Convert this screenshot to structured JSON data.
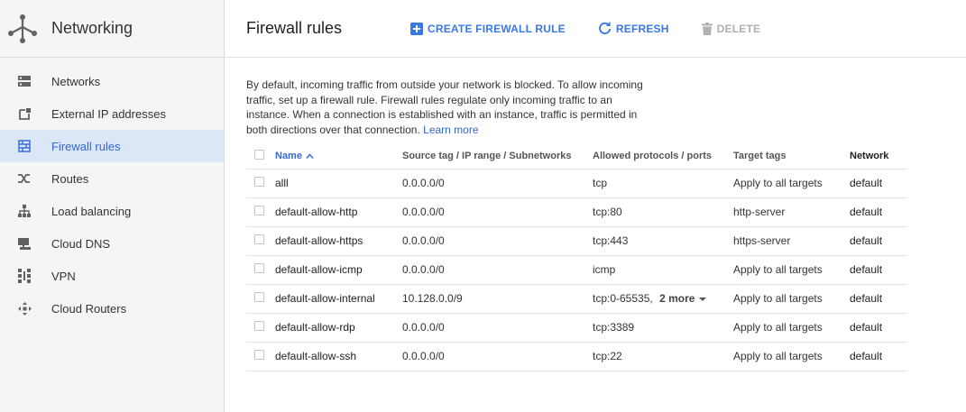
{
  "app": {
    "title": "Networking",
    "logo_icon": "networking-logo-icon"
  },
  "sidebar": {
    "items": [
      {
        "label": "Networks",
        "icon": "networks-icon",
        "active": false
      },
      {
        "label": "External IP addresses",
        "icon": "external-ip-icon",
        "active": false
      },
      {
        "label": "Firewall rules",
        "icon": "firewall-icon",
        "active": true
      },
      {
        "label": "Routes",
        "icon": "routes-icon",
        "active": false
      },
      {
        "label": "Load balancing",
        "icon": "load-balancing-icon",
        "active": false
      },
      {
        "label": "Cloud DNS",
        "icon": "cloud-dns-icon",
        "active": false
      },
      {
        "label": "VPN",
        "icon": "vpn-icon",
        "active": false
      },
      {
        "label": "Cloud Routers",
        "icon": "cloud-routers-icon",
        "active": false
      }
    ]
  },
  "toolbar": {
    "page_title": "Firewall rules",
    "create_label": "CREATE FIREWALL RULE",
    "refresh_label": "REFRESH",
    "delete_label": "DELETE"
  },
  "intro": {
    "text": "By default, incoming traffic from outside your network is blocked. To allow incoming traffic, set up a firewall rule. Firewall rules regulate only incoming traffic to an instance. When a connection is established with an instance, traffic is permitted in both directions over that connection.",
    "link": "Learn more"
  },
  "table": {
    "headers": {
      "name": "Name",
      "source": "Source tag / IP range / Subnetworks",
      "protocols": "Allowed protocols / ports",
      "targets": "Target tags",
      "network": "Network"
    },
    "sort": {
      "column": "name",
      "direction": "ascending"
    },
    "rows": [
      {
        "name": "alll",
        "source": "0.0.0.0/0",
        "protocols": "tcp",
        "more": "",
        "targets": "Apply to all targets",
        "network": "default"
      },
      {
        "name": "default-allow-http",
        "source": "0.0.0.0/0",
        "protocols": "tcp:80",
        "more": "",
        "targets": "http-server",
        "network": "default"
      },
      {
        "name": "default-allow-https",
        "source": "0.0.0.0/0",
        "protocols": "tcp:443",
        "more": "",
        "targets": "https-server",
        "network": "default"
      },
      {
        "name": "default-allow-icmp",
        "source": "0.0.0.0/0",
        "protocols": "icmp",
        "more": "",
        "targets": "Apply to all targets",
        "network": "default"
      },
      {
        "name": "default-allow-internal",
        "source": "10.128.0.0/9",
        "protocols": "tcp:0-65535,",
        "more": "2 more",
        "targets": "Apply to all targets",
        "network": "default"
      },
      {
        "name": "default-allow-rdp",
        "source": "0.0.0.0/0",
        "protocols": "tcp:3389",
        "more": "",
        "targets": "Apply to all targets",
        "network": "default"
      },
      {
        "name": "default-allow-ssh",
        "source": "0.0.0.0/0",
        "protocols": "tcp:22",
        "more": "",
        "targets": "Apply to all targets",
        "network": "default"
      }
    ]
  },
  "colors": {
    "accent": "#3b78e7",
    "active_bg": "#dbe6f6",
    "sidebar_bg": "#f5f5f5",
    "disabled": "#b0b0b0"
  }
}
